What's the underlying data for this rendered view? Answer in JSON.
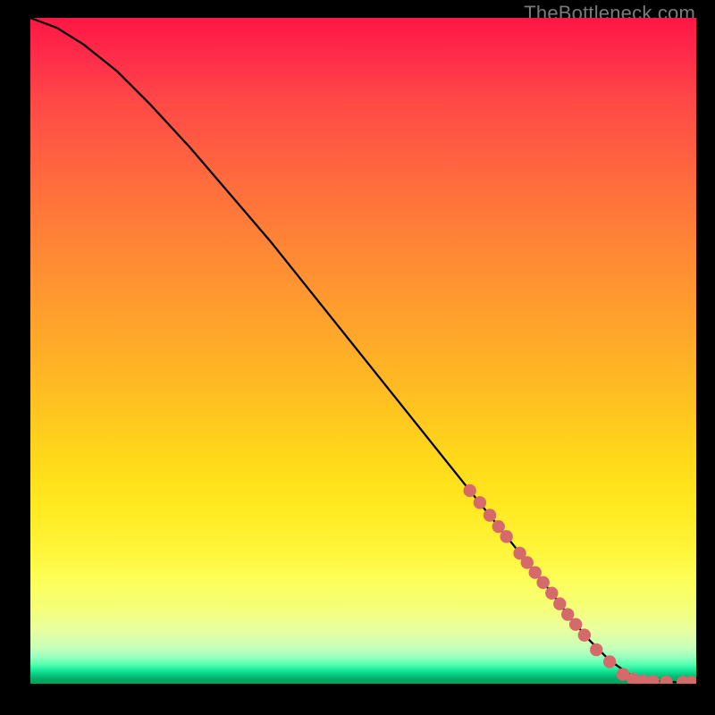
{
  "watermark": "TheBottleneck.com",
  "colors": {
    "curve": "#000000",
    "marker": "#d66a6a",
    "background": "#000000"
  },
  "chart_data": {
    "type": "line",
    "title": "",
    "xlabel": "",
    "ylabel": "",
    "xlim": [
      0,
      100
    ],
    "ylim": [
      0,
      100
    ],
    "grid": false,
    "legend": false,
    "series": [
      {
        "name": "bottleneck-curve",
        "x": [
          0,
          4,
          8,
          13,
          18,
          24,
          30,
          36,
          42,
          48,
          54,
          60,
          66,
          70,
          74,
          78,
          81,
          84,
          87,
          90,
          93,
          96,
          98,
          100
        ],
        "y": [
          100,
          98.5,
          96,
          92,
          87,
          80.5,
          73.5,
          66.5,
          59,
          51.5,
          44,
          36.5,
          29,
          24,
          19,
          14,
          10,
          6.5,
          3.5,
          1.4,
          0.5,
          0.25,
          0.2,
          0.2
        ]
      }
    ],
    "markers": {
      "name": "highlighted-points",
      "style": "thick-dot",
      "color": "#d66a6a",
      "points": [
        {
          "x": 66,
          "y": 29
        },
        {
          "x": 67.5,
          "y": 27.2
        },
        {
          "x": 69,
          "y": 25.3
        },
        {
          "x": 70.3,
          "y": 23.6
        },
        {
          "x": 71.5,
          "y": 22.1
        },
        {
          "x": 73.5,
          "y": 19.6
        },
        {
          "x": 74.6,
          "y": 18.2
        },
        {
          "x": 75.8,
          "y": 16.7
        },
        {
          "x": 77,
          "y": 15.2
        },
        {
          "x": 78.3,
          "y": 13.6
        },
        {
          "x": 79.5,
          "y": 12
        },
        {
          "x": 80.7,
          "y": 10.4
        },
        {
          "x": 81.9,
          "y": 8.9
        },
        {
          "x": 83.2,
          "y": 7.3
        },
        {
          "x": 85,
          "y": 5.1
        },
        {
          "x": 87,
          "y": 3.3
        },
        {
          "x": 89,
          "y": 1.4
        },
        {
          "x": 90.5,
          "y": 0.7
        },
        {
          "x": 92,
          "y": 0.4
        },
        {
          "x": 93.5,
          "y": 0.3
        },
        {
          "x": 95.5,
          "y": 0.25
        },
        {
          "x": 98,
          "y": 0.2
        },
        {
          "x": 99.3,
          "y": 0.2
        }
      ]
    }
  }
}
